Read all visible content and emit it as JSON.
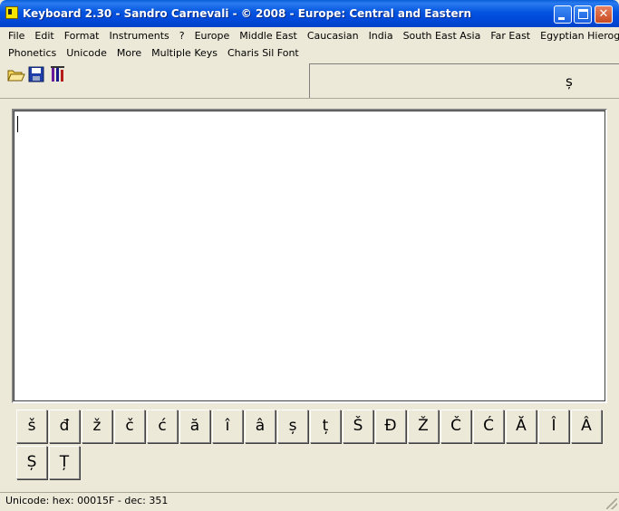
{
  "window": {
    "title": "Keyboard 2.30 - Sandro Carnevali - ©  2008 - Europe: Central and Eastern",
    "close_glyph": "✕"
  },
  "menu": {
    "row1": [
      "File",
      "Edit",
      "Format",
      "Instruments",
      "?",
      "Europe",
      "Middle East",
      "Caucasian",
      "India",
      "South East Asia",
      "Far East",
      "Egyptian Hieroglyphs"
    ],
    "row2": [
      "Phonetics",
      "Unicode",
      "More",
      "Multiple Keys",
      "Charis Sil Font"
    ]
  },
  "toolbar": {
    "buttons": [
      {
        "name": "open-icon"
      },
      {
        "name": "save-icon"
      },
      {
        "name": "font-icon"
      }
    ]
  },
  "char_panel": {
    "value": "ș"
  },
  "editor": {
    "value": ""
  },
  "keys": {
    "row1": [
      "š",
      "đ",
      "ž",
      "č",
      "ć",
      "ă",
      "î",
      "â",
      "ș",
      "ț",
      "Š",
      "Đ",
      "Ž",
      "Č",
      "Ć",
      "Ă",
      "Î",
      "Â"
    ],
    "row2": [
      "Ș",
      "Ț"
    ]
  },
  "status": {
    "text": "Unicode: hex: 00015F - dec: 351"
  },
  "colors": {
    "titlebar": "#0054E3",
    "face": "#ECE9D8"
  }
}
